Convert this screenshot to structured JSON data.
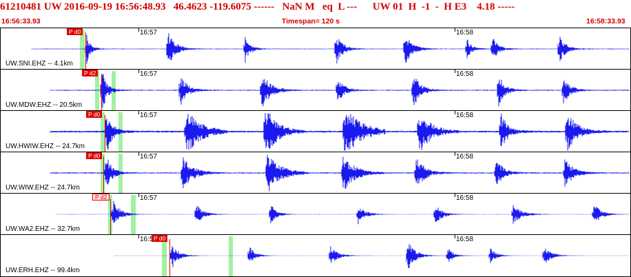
{
  "header": {
    "line": "61210481 UW 2016-09-19 16:56:48.93   46.4623 -119.6075 ------   NaN M   eq  L ---      UW 01  H  -1  -  H E3    4.18 -----",
    "start_time": "16:56:33.93",
    "timespan": "Timespan= 120 s",
    "end_time": "16:58:33.93"
  },
  "time_axis": {
    "tick_labels": [
      "16:57",
      "16:58"
    ]
  },
  "colors": {
    "trace": "#0000ee",
    "pick": "#e00000",
    "header": "#d40000",
    "window": "#90ee90"
  },
  "panels": [
    {
      "label": "UW.SNI.EHZ -- 4.1km",
      "pick": "P d0",
      "pick_style": "filled",
      "noise": 0.18,
      "gain": 1.0,
      "trace_start": 0.05
    },
    {
      "label": "UW.MDW.EHZ -- 20.5km",
      "pick": "P d2",
      "pick_style": "filled",
      "noise": 0.22,
      "gain": 1.1,
      "trace_start": 0.08
    },
    {
      "label": "UW.HWIW.EHZ -- 24.7km",
      "pick": "P d0",
      "pick_style": "filled",
      "noise": 0.3,
      "gain": 1.5,
      "trace_start": 0.08
    },
    {
      "label": "UW.WIW.EHZ -- 24.7km",
      "pick": "P d0",
      "pick_style": "filled",
      "noise": 0.25,
      "gain": 1.2,
      "trace_start": 0.08
    },
    {
      "label": "UW.WA2.EHZ -- 32.7km",
      "pick": "P d2",
      "pick_style": "outline",
      "noise": 0.08,
      "gain": 0.8,
      "trace_start": 0.09
    },
    {
      "label": "UW.ERH.EHZ -- 99.4km",
      "pick": "P d0",
      "pick_style": "filled",
      "noise": 0.05,
      "gain": 0.9,
      "trace_start": 0.18
    }
  ]
}
